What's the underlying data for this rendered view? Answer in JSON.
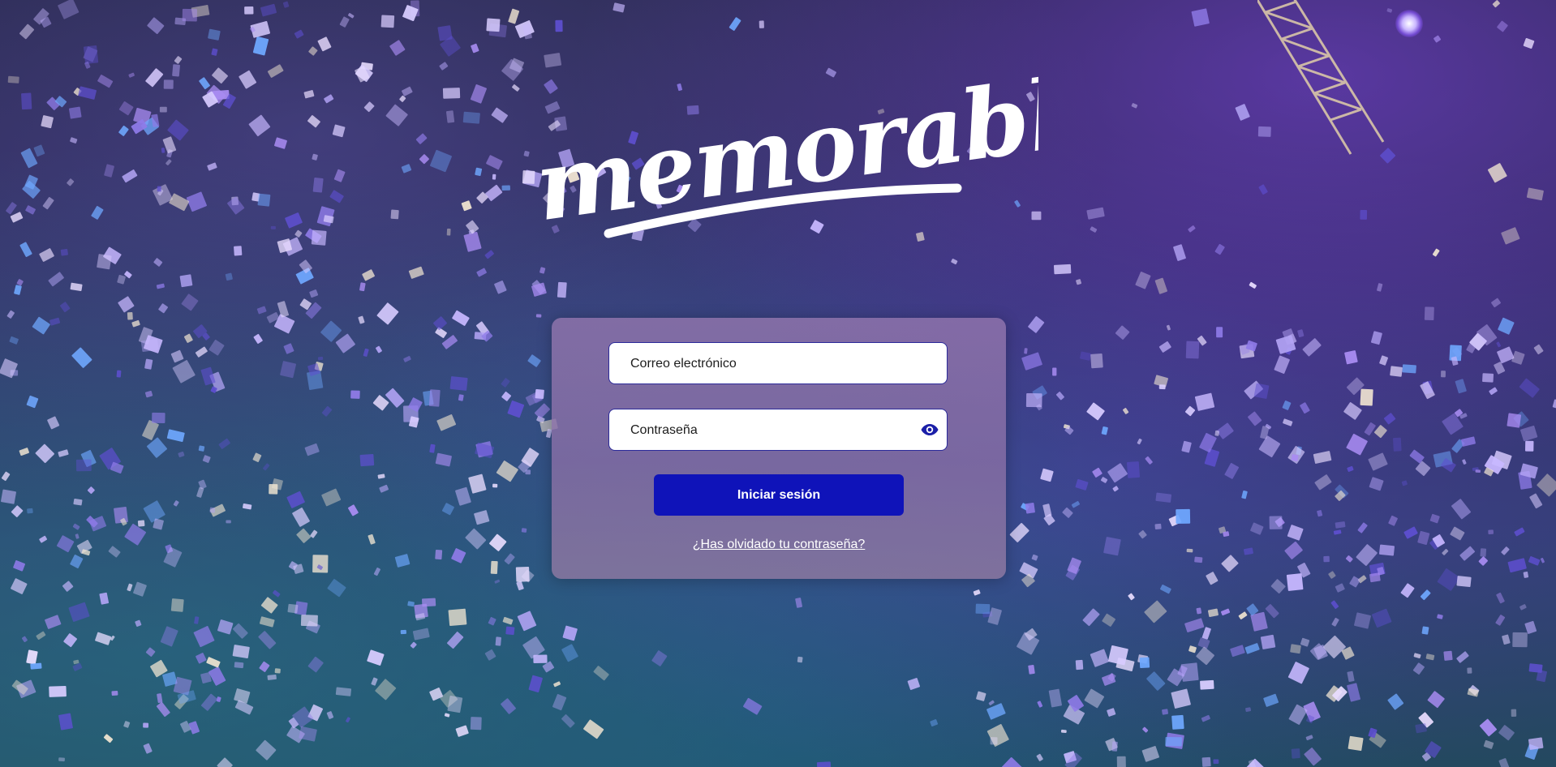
{
  "brand": {
    "logo_text": "memorable"
  },
  "login": {
    "email_placeholder": "Correo electrónico",
    "email_value": "",
    "password_placeholder": "Contraseña",
    "password_value": "",
    "show_password_icon": "eye-icon",
    "submit_label": "Iniciar sesión",
    "forgot_link": "¿Has olvidado tu contraseña?"
  },
  "colors": {
    "accent": "#0f13b9",
    "field_border": "#2b2a9a",
    "panel_tint": "#8e76a8",
    "logo": "#ffffff"
  }
}
